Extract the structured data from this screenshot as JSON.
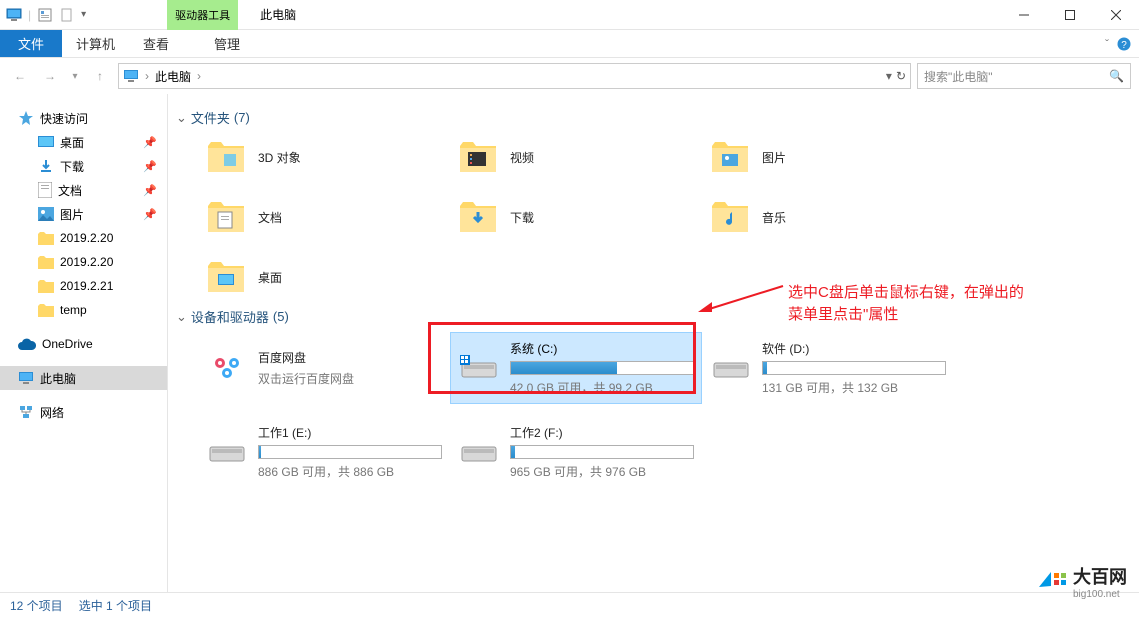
{
  "title": "此电脑",
  "tab_tools": "驱动器工具",
  "menu": {
    "file": "文件",
    "computer": "计算机",
    "view": "查看",
    "manage": "管理"
  },
  "breadcrumb": {
    "root": "此电脑"
  },
  "search": {
    "placeholder": "搜索\"此电脑\""
  },
  "nav": {
    "quick": "快速访问",
    "desktop": "桌面",
    "downloads": "下载",
    "documents": "文档",
    "pictures": "图片",
    "f1": "2019.2.20",
    "f2": "2019.2.20",
    "f3": "2019.2.21",
    "f4": "temp",
    "onedrive": "OneDrive",
    "thispc": "此电脑",
    "network": "网络"
  },
  "groups": {
    "folders": {
      "title": "文件夹",
      "count": "(7)"
    },
    "devices": {
      "title": "设备和驱动器",
      "count": "(5)"
    }
  },
  "folders": {
    "obj3d": "3D 对象",
    "videos": "视频",
    "pictures": "图片",
    "documents": "文档",
    "downloads": "下载",
    "music": "音乐",
    "desktop": "桌面"
  },
  "drives": {
    "baidu": {
      "name": "百度网盘",
      "sub": "双击运行百度网盘"
    },
    "c": {
      "name": "系统 (C:)",
      "sub": "42.0 GB 可用，共 99.2 GB",
      "fill": 58
    },
    "d": {
      "name": "软件 (D:)",
      "sub": "131 GB 可用，共 132 GB",
      "fill": 2
    },
    "e": {
      "name": "工作1 (E:)",
      "sub": "886 GB 可用，共 886 GB",
      "fill": 1
    },
    "f": {
      "name": "工作2 (F:)",
      "sub": "965 GB 可用，共 976 GB",
      "fill": 2
    }
  },
  "annotation": {
    "line1": "选中C盘后单击鼠标右键，在弹出的",
    "line2": "菜单里点击\"属性"
  },
  "status": {
    "items": "12 个项目",
    "selected": "选中 1 个项目"
  },
  "watermark": {
    "name": "大百网",
    "url": "big100.net"
  }
}
